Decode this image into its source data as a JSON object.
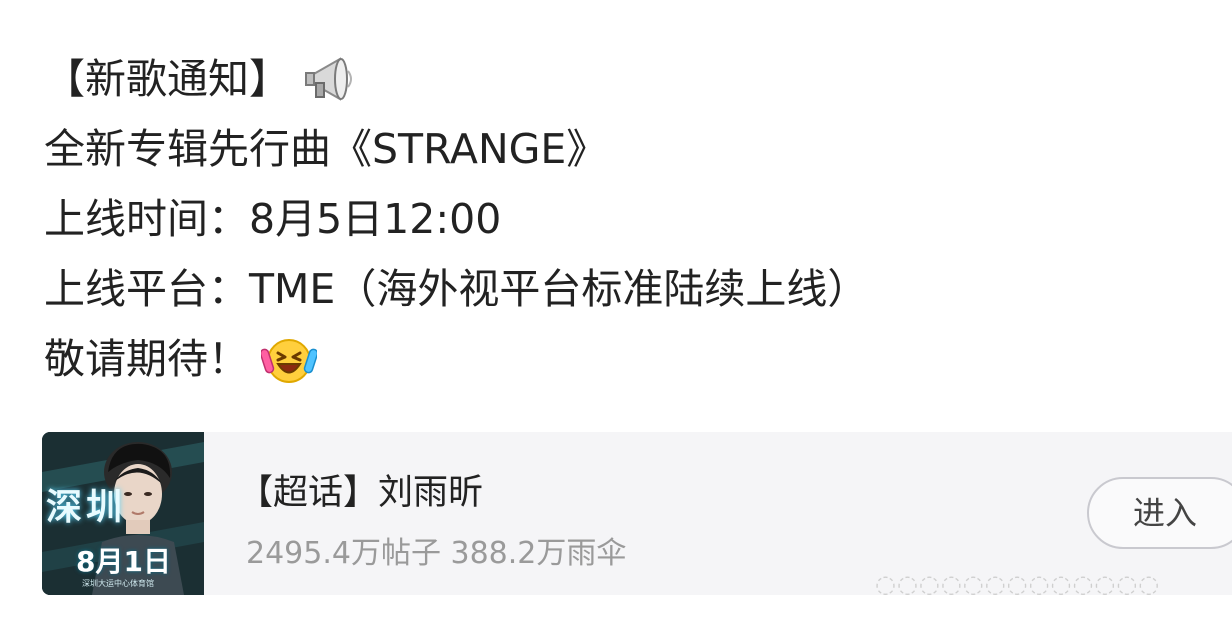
{
  "post": {
    "lines": [
      "【新歌通知】",
      "全新专辑先行曲《STRANGE》",
      "上线时间：8月5日12:00",
      "上线平台：TME（海外视平台标准陆续上线）",
      "敬请期待！"
    ],
    "emoji_1": "megaphone-icon",
    "emoji_2": "laughing-emoji-icon"
  },
  "supertopic_card": {
    "title": "【超话】刘雨昕",
    "stats": "2495.4万帖子 388.2万雨伞",
    "enter_label": "进入",
    "cover": {
      "big_text": "深圳",
      "date_text": "8月1日",
      "sub_text": "深圳大运中心体育馆"
    }
  },
  "colors": {
    "text": "#222222",
    "muted": "#9a9a9a",
    "card_bg": "#f5f5f7",
    "button_border": "#c9c9cf"
  }
}
